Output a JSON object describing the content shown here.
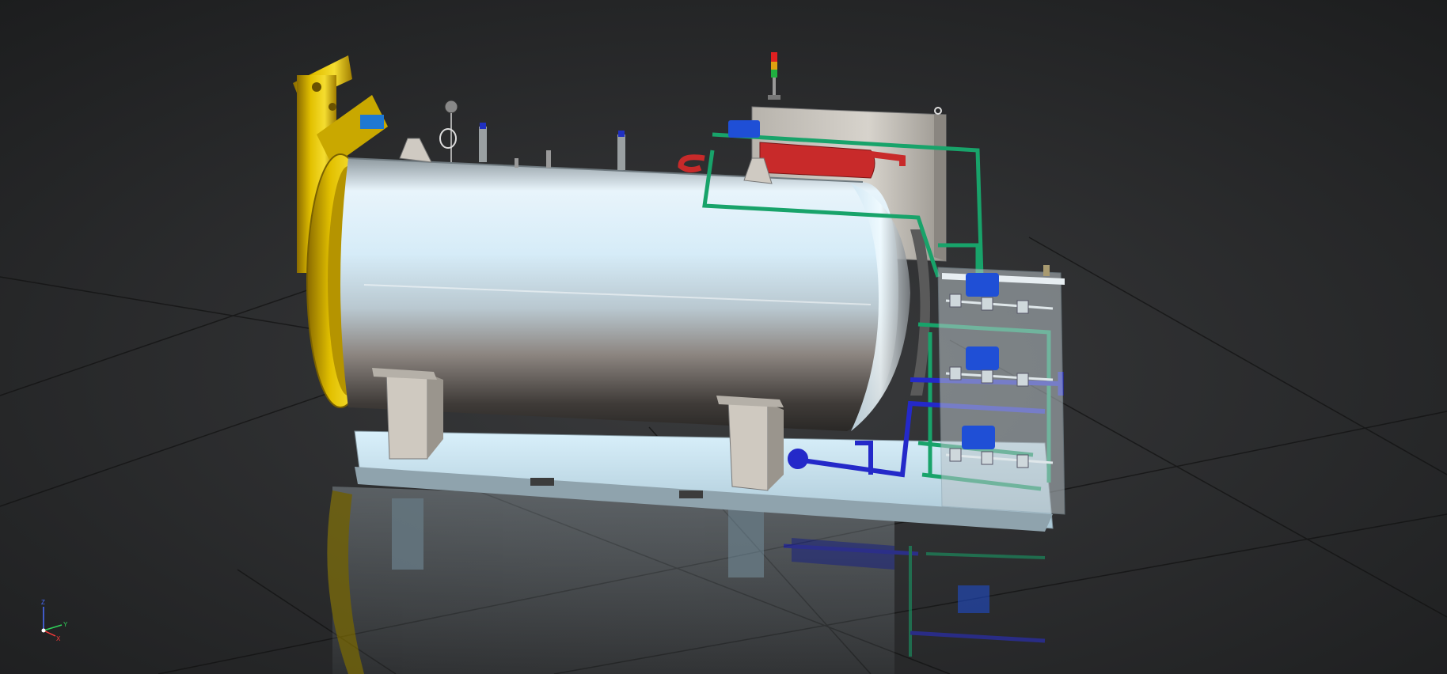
{
  "app": {
    "mode": "3d-viewport"
  },
  "view_triad": {
    "axes": [
      {
        "label": "Z",
        "color": "#4a6cff"
      },
      {
        "label": "Y",
        "color": "#2fd35a"
      },
      {
        "label": "X",
        "color": "#ff3b3b"
      }
    ]
  },
  "colors": {
    "background": "#232425",
    "vessel_body": "#c9d7de",
    "door_ring": "#d4b000",
    "green_pipe": "#18a36a",
    "blue_pipe": "#2429c9",
    "red_pipe": "#c82a2a",
    "valve_actuator": "#1f4fd6"
  },
  "model": {
    "components": [
      "vessel-body",
      "door-ring",
      "door-hinge-assembly",
      "base-frame",
      "saddle-supports",
      "control-cabinet",
      "signal-tower",
      "steam-pipe-green",
      "water-pipe-blue",
      "heater-red",
      "valve-skid",
      "floor-reflection"
    ]
  }
}
